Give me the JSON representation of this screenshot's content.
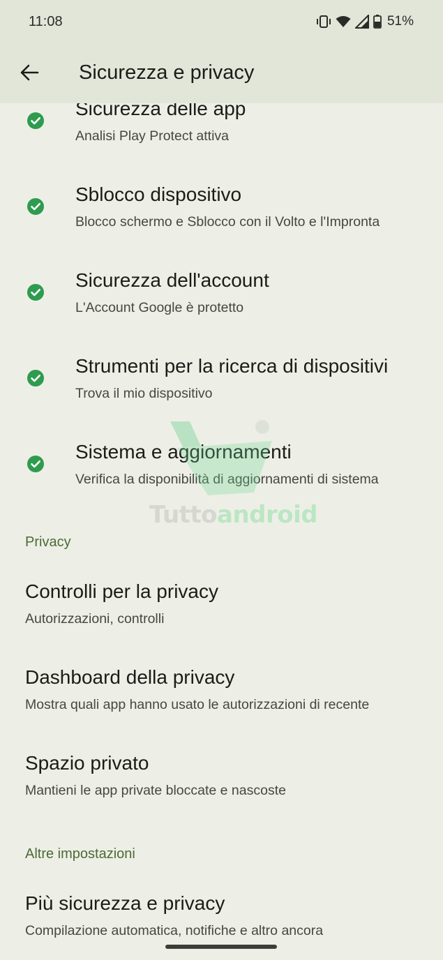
{
  "status_bar": {
    "time": "11:08",
    "battery_percent": "51%",
    "icons": [
      "vibrate-icon",
      "wifi-icon",
      "cell-signal-icon",
      "battery-icon"
    ]
  },
  "app_bar": {
    "back_icon": "arrow-back-icon",
    "title": "Sicurezza e privacy"
  },
  "security_items": [
    {
      "title": "Sicurezza delle app",
      "subtitle": "Analisi Play Protect attiva",
      "status_icon": "check-circle-icon"
    },
    {
      "title": "Sblocco dispositivo",
      "subtitle": "Blocco schermo e Sblocco con il Volto e l'Impronta",
      "status_icon": "check-circle-icon"
    },
    {
      "title": "Sicurezza dell'account",
      "subtitle": "L'Account Google è protetto",
      "status_icon": "check-circle-icon"
    },
    {
      "title": "Strumenti per la ricerca di dispositivi",
      "subtitle": "Trova il mio dispositivo",
      "status_icon": "check-circle-icon"
    },
    {
      "title": "Sistema e aggiornamenti",
      "subtitle": "Verifica la disponibilità di aggiornamenti di sistema",
      "status_icon": "check-circle-icon"
    }
  ],
  "privacy_section": {
    "header": "Privacy",
    "items": [
      {
        "title": "Controlli per la privacy",
        "subtitle": "Autorizzazioni, controlli"
      },
      {
        "title": "Dashboard della privacy",
        "subtitle": "Mostra quali app hanno usato le autorizzazioni di recente"
      },
      {
        "title": "Spazio privato",
        "subtitle": "Mantieni le app private bloccate e nascoste"
      }
    ]
  },
  "other_section": {
    "header": "Altre impostazioni",
    "items": [
      {
        "title": "Più sicurezza e privacy",
        "subtitle": "Compilazione automatica, notifiche e altro ancora"
      }
    ]
  },
  "watermark": {
    "part1": "Tutto",
    "part2": "android"
  },
  "colors": {
    "background": "#edefe6",
    "app_bar": "#e1e6d9",
    "check_green": "#2e9b4e",
    "section_header": "#4c6a35"
  }
}
